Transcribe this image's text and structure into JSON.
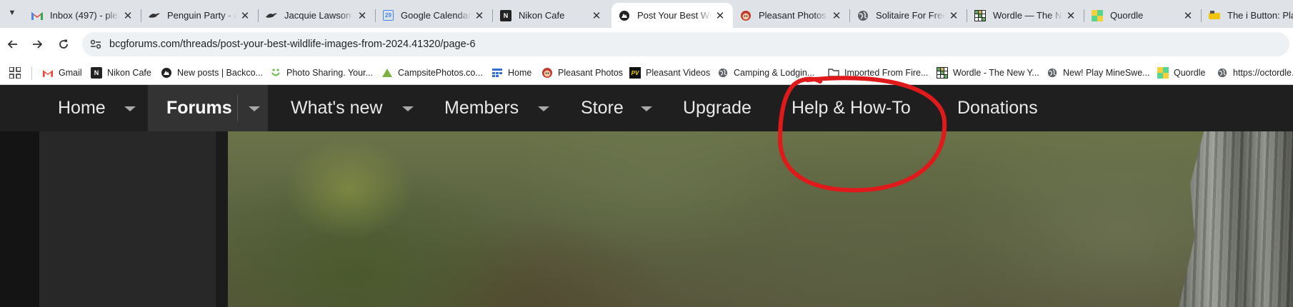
{
  "tabs": [
    {
      "title": "Inbox (497) - plea",
      "icon": "gmail-icon",
      "active": false
    },
    {
      "title": "Penguin Party - a",
      "icon": "jacquie-lawson-bird-icon",
      "active": false
    },
    {
      "title": "Jacquie Lawson C",
      "icon": "jacquie-lawson-bird-icon",
      "active": false
    },
    {
      "title": "Google Calendar",
      "icon": "google-calendar-icon",
      "active": false
    },
    {
      "title": "Nikon Cafe",
      "icon": "nikon-cafe-icon",
      "active": false
    },
    {
      "title": "Post Your Best Wi",
      "icon": "bcg-forums-icon",
      "active": true
    },
    {
      "title": "Pleasant Photos",
      "icon": "pleasant-photos-icon",
      "active": false
    },
    {
      "title": "Solitaire For Free",
      "icon": "globe-icon",
      "active": false
    },
    {
      "title": "Wordle — The Ne",
      "icon": "wordle-icon",
      "active": false
    },
    {
      "title": "Quordle",
      "icon": "quordle-icon",
      "active": false
    },
    {
      "title": "The i Button: Play",
      "icon": "i-button-icon",
      "active": false
    }
  ],
  "calendar_icon_day": "29",
  "address_bar": {
    "url": "bcgforums.com/threads/post-your-best-wildlife-images-from-2024.41320/page-6"
  },
  "bookmarks": [
    {
      "label": "Gmail",
      "icon": "gmail-icon"
    },
    {
      "label": "Nikon Cafe",
      "icon": "nikon-cafe-icon"
    },
    {
      "label": "New posts | Backco...",
      "icon": "bcg-forums-icon"
    },
    {
      "label": "Photo Sharing. Your...",
      "icon": "smugmug-icon"
    },
    {
      "label": "CampsitePhotos.co...",
      "icon": "tent-icon"
    },
    {
      "label": "Home",
      "icon": "home-grid-icon"
    },
    {
      "label": "Pleasant Photos",
      "icon": "pleasant-photos-icon"
    },
    {
      "label": "Pleasant Videos",
      "icon": "pleasant-videos-icon"
    },
    {
      "label": "Camping & Lodgin...",
      "icon": "globe-icon"
    },
    {
      "label": "Imported From Fire...",
      "icon": "folder-icon"
    },
    {
      "label": "Wordle - The New Y...",
      "icon": "wordle-icon"
    },
    {
      "label": "New! Play MineSwe...",
      "icon": "globe-icon"
    },
    {
      "label": "Quordle",
      "icon": "quordle-icon"
    },
    {
      "label": "https://octordle...",
      "icon": "globe-icon"
    }
  ],
  "site_nav": [
    {
      "label": "Home",
      "has_menu": true
    },
    {
      "label": "Forums",
      "has_menu": true,
      "active": true
    },
    {
      "label": "What's new",
      "has_menu": true
    },
    {
      "label": "Members",
      "has_menu": true
    },
    {
      "label": "Store",
      "has_menu": true
    },
    {
      "label": "Upgrade",
      "has_menu": false
    },
    {
      "label": "Help & How-To",
      "has_menu": false,
      "highlighted": true
    },
    {
      "label": "Donations",
      "has_menu": false
    }
  ],
  "colors": {
    "tabstrip_bg": "#dfe3e8",
    "nav_bg": "#1f1f1f",
    "nav_active_bg": "#333333",
    "annotation_circle": "#e0191b"
  }
}
